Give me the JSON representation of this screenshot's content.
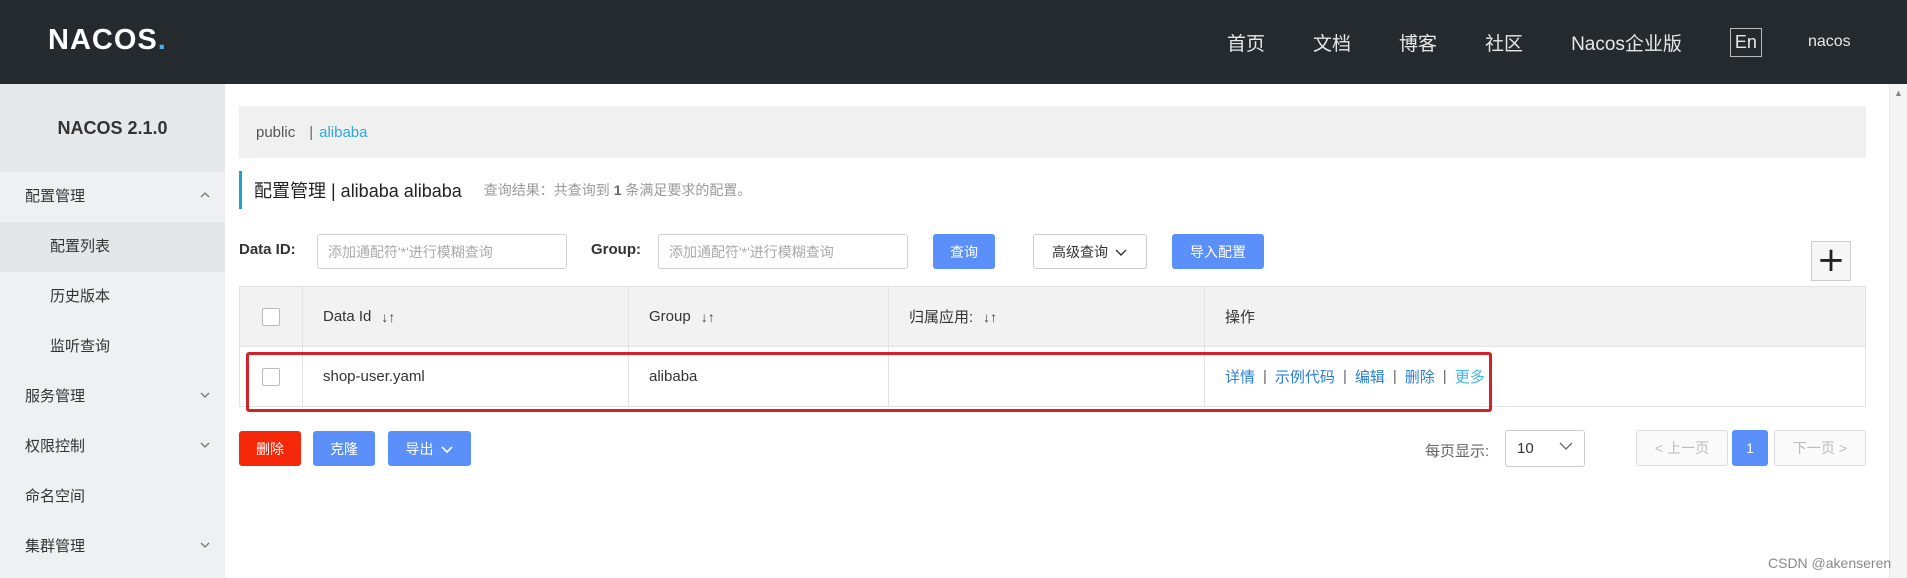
{
  "header": {
    "logo": "NACOS",
    "nav": [
      "首页",
      "文档",
      "博客",
      "社区",
      "Nacos企业版"
    ],
    "lang_button": "En",
    "user": "nacos"
  },
  "sidebar": {
    "version": "NACOS 2.1.0",
    "items": [
      {
        "label": "配置管理",
        "icon": "chevron-up-icon"
      },
      {
        "label": "配置列表"
      },
      {
        "label": "历史版本"
      },
      {
        "label": "监听查询"
      },
      {
        "label": "服务管理",
        "icon": "chevron-down-icon"
      },
      {
        "label": "权限控制",
        "icon": "chevron-down-icon"
      },
      {
        "label": "命名空间"
      },
      {
        "label": "集群管理",
        "icon": "chevron-down-icon"
      }
    ]
  },
  "namespace_bar": {
    "items": [
      "public",
      "|",
      "alibaba"
    ]
  },
  "page": {
    "title": "配置管理 | alibaba alibaba",
    "summary_prefix": "查询结果：共查询到",
    "summary_count": "1",
    "summary_suffix": "条满足要求的配置。"
  },
  "search": {
    "dataid_label": "Data ID:",
    "dataid_placeholder": "添加通配符'*'进行模糊查询",
    "group_label": "Group:",
    "group_placeholder": "添加通配符'*'进行模糊查询",
    "query_button": "查询",
    "advanced_button": "高级查询",
    "import_button": "导入配置",
    "add_button": "+"
  },
  "table": {
    "headers": [
      "Data Id",
      "Group",
      "归属应用:",
      "操作"
    ],
    "rows": [
      {
        "data_id": "shop-user.yaml",
        "group": "alibaba",
        "app": "",
        "ops": [
          "详情",
          "示例代码",
          "编辑",
          "删除",
          "更多"
        ]
      }
    ]
  },
  "bottom": {
    "delete_button": "删除",
    "clone_button": "克隆",
    "export_button": "导出",
    "page_size_label": "每页显示:",
    "page_size": "10",
    "prev": "上一页",
    "current_page": "1",
    "next": "下一页"
  },
  "watermark": "CSDN @akenseren",
  "colors": {
    "header_bg": "#252a2f",
    "primary": "#5b8ff9",
    "danger": "#f5290a",
    "link": "#2a7fd4",
    "highlight": "#d2232a"
  }
}
